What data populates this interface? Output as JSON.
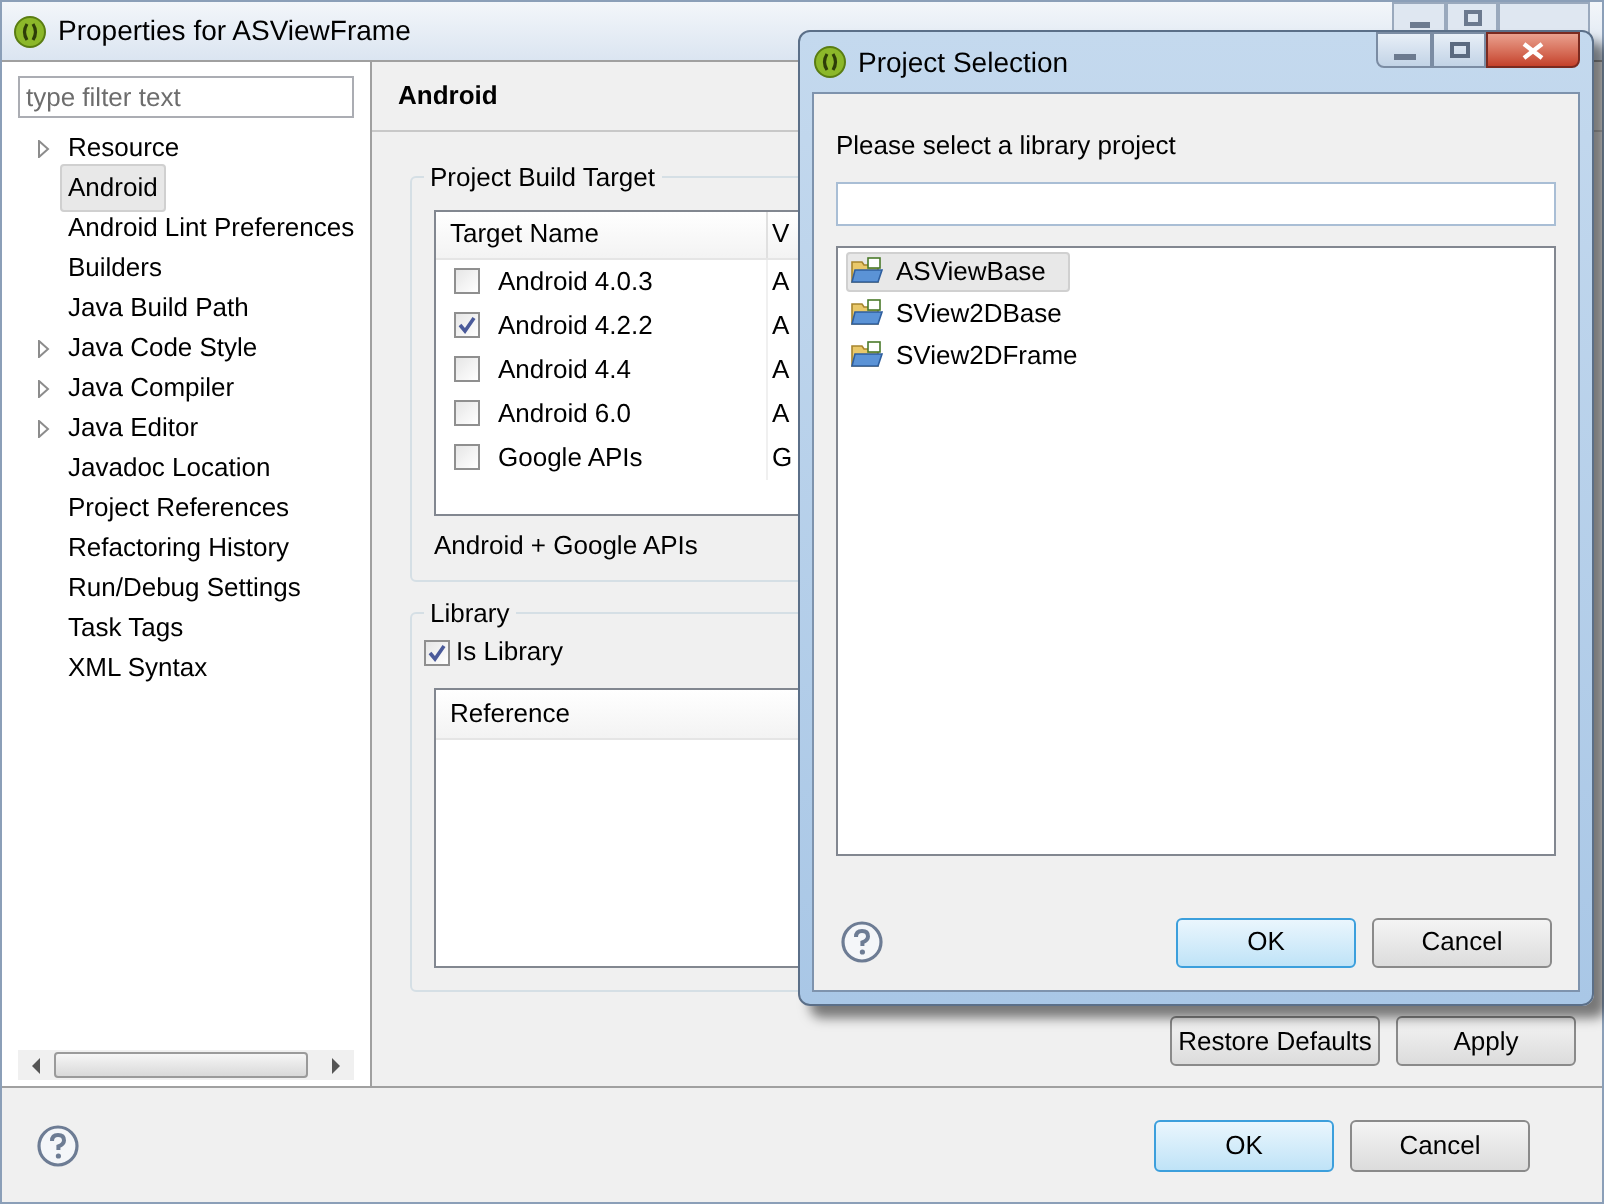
{
  "window": {
    "title": "Properties for ASViewFrame"
  },
  "filter": {
    "placeholder": "type filter text"
  },
  "tree": [
    {
      "label": "Resource",
      "expandable": true,
      "selected": false
    },
    {
      "label": "Android",
      "expandable": false,
      "selected": true
    },
    {
      "label": "Android Lint Preferences",
      "expandable": false,
      "selected": false
    },
    {
      "label": "Builders",
      "expandable": false,
      "selected": false
    },
    {
      "label": "Java Build Path",
      "expandable": false,
      "selected": false
    },
    {
      "label": "Java Code Style",
      "expandable": true,
      "selected": false
    },
    {
      "label": "Java Compiler",
      "expandable": true,
      "selected": false
    },
    {
      "label": "Java Editor",
      "expandable": true,
      "selected": false
    },
    {
      "label": "Javadoc Location",
      "expandable": false,
      "selected": false
    },
    {
      "label": "Project References",
      "expandable": false,
      "selected": false
    },
    {
      "label": "Refactoring History",
      "expandable": false,
      "selected": false
    },
    {
      "label": "Run/Debug Settings",
      "expandable": false,
      "selected": false
    },
    {
      "label": "Task Tags",
      "expandable": false,
      "selected": false
    },
    {
      "label": "XML Syntax",
      "expandable": false,
      "selected": false
    }
  ],
  "page_title": "Android",
  "build_target": {
    "title": "Project Build Target",
    "columns": [
      "Target Name",
      "V"
    ],
    "rows": [
      {
        "name": "Android 4.0.3",
        "checked": false,
        "column_2": "A"
      },
      {
        "name": "Android 4.2.2",
        "checked": true,
        "column_2": "A"
      },
      {
        "name": "Android 4.4",
        "checked": false,
        "column_2": "A"
      },
      {
        "name": "Android 6.0",
        "checked": false,
        "column_2": "A"
      },
      {
        "name": "Google APIs",
        "checked": false,
        "column_2": "G"
      }
    ],
    "footer": "Android + Google APIs"
  },
  "library": {
    "title": "Library",
    "is_library": {
      "label": "Is Library",
      "checked": true
    },
    "columns": [
      "Reference"
    ]
  },
  "page_buttons": [
    {
      "label": "Restore Defaults",
      "default": false
    },
    {
      "label": "Apply",
      "default": false
    }
  ],
  "buttons": [
    {
      "label": "OK",
      "default": true
    },
    {
      "label": "Cancel",
      "default": false
    }
  ],
  "dialog": {
    "title": "Project Selection",
    "prompt": "Please select a library project",
    "projects": [
      {
        "name": "ASViewBase",
        "selected": true
      },
      {
        "name": "SView2DBase",
        "selected": false
      },
      {
        "name": "SView2DFrame",
        "selected": false
      }
    ],
    "buttons": [
      {
        "label": "OK",
        "default": true
      },
      {
        "label": "Cancel",
        "default": false
      }
    ]
  }
}
